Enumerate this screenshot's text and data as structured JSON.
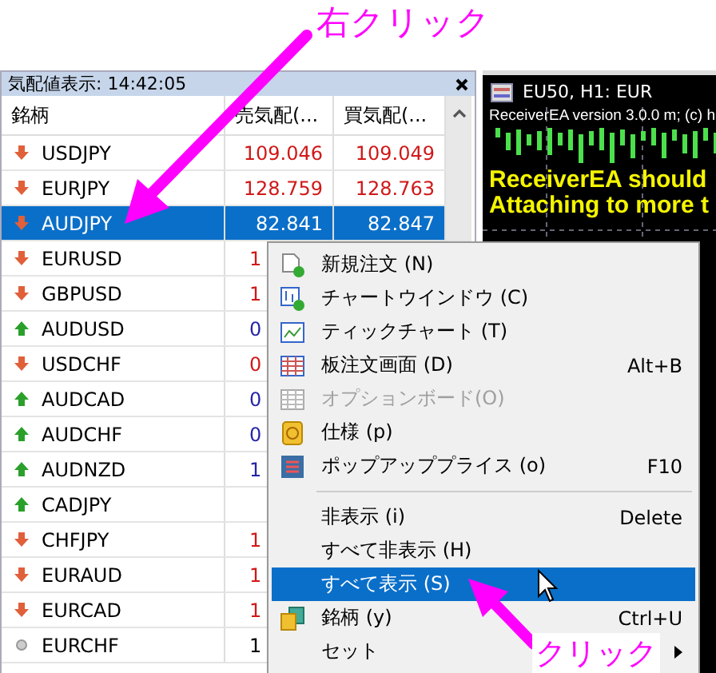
{
  "annotations": {
    "right_click": "右クリック",
    "click": "クリック"
  },
  "quotes_panel": {
    "title": "気配値表示: 14:42:05",
    "columns": [
      "銘柄",
      "売気配(...",
      "買気配(..."
    ],
    "rows": [
      {
        "symbol": "USDJPY",
        "kind": "down",
        "bid": "109.046",
        "ask": "109.049",
        "selected": false
      },
      {
        "symbol": "EURJPY",
        "kind": "down",
        "bid": "128.759",
        "ask": "128.763",
        "selected": false
      },
      {
        "symbol": "AUDJPY",
        "kind": "down",
        "bid": "82.841",
        "ask": "82.847",
        "selected": true
      },
      {
        "symbol": "EURUSD",
        "kind": "down",
        "bid": "1",
        "selected": false
      },
      {
        "symbol": "GBPUSD",
        "kind": "down",
        "bid": "1",
        "selected": false
      },
      {
        "symbol": "AUDUSD",
        "kind": "up",
        "bid": "0",
        "selected": false
      },
      {
        "symbol": "USDCHF",
        "kind": "down",
        "bid": "0",
        "selected": false
      },
      {
        "symbol": "AUDCAD",
        "kind": "up",
        "bid": "0",
        "selected": false
      },
      {
        "symbol": "AUDCHF",
        "kind": "up",
        "bid": "0",
        "selected": false
      },
      {
        "symbol": "AUDNZD",
        "kind": "up",
        "bid": "1",
        "selected": false
      },
      {
        "symbol": "CADJPY",
        "kind": "up",
        "selected": false
      },
      {
        "symbol": "CHFJPY",
        "kind": "down",
        "bid": "1",
        "selected": false
      },
      {
        "symbol": "EURAUD",
        "kind": "down",
        "bid": "1",
        "selected": false
      },
      {
        "symbol": "EURCAD",
        "kind": "down",
        "bid": "1",
        "selected": false
      },
      {
        "symbol": "EURCHF",
        "kind": "neutral",
        "bid": "1",
        "selected": false
      }
    ]
  },
  "chart_window": {
    "title": "EU50, H1: EUR",
    "subtitle": "ReceiverEA version 3.0.0 m; (c) h",
    "messages": [
      "ReceiverEA should",
      "Attaching to more t"
    ]
  },
  "context_menu": [
    {
      "kind": "item",
      "label": "新規注文 (N)",
      "disabled": false,
      "selected": false
    },
    {
      "kind": "item",
      "label": "チャートウインドウ (C)",
      "disabled": false,
      "selected": false
    },
    {
      "kind": "item",
      "label": "ティックチャート (T)",
      "disabled": false,
      "selected": false
    },
    {
      "kind": "item",
      "label": "板注文画面 (D)",
      "shortcut": "Alt+B",
      "disabled": false,
      "selected": false
    },
    {
      "kind": "item",
      "label": "オプションボード(O)",
      "disabled": true,
      "selected": false
    },
    {
      "kind": "item",
      "label": "仕様 (p)",
      "disabled": false,
      "selected": false
    },
    {
      "kind": "item",
      "label": "ポップアッププライス (o)",
      "shortcut": "F10",
      "disabled": false,
      "selected": false
    },
    {
      "kind": "separator"
    },
    {
      "kind": "item",
      "label": "非表示 (i)",
      "shortcut": "Delete",
      "disabled": false,
      "selected": false
    },
    {
      "kind": "item",
      "label": "すべて非表示 (H)",
      "disabled": false,
      "selected": false
    },
    {
      "kind": "item",
      "label": "すべて表示 (S)",
      "disabled": false,
      "selected": true
    },
    {
      "kind": "item",
      "label": "銘柄 (y)",
      "shortcut": "Ctrl+U",
      "disabled": false,
      "selected": false
    },
    {
      "kind": "submenu",
      "label": "セット",
      "disabled": false,
      "selected": false
    }
  ]
}
